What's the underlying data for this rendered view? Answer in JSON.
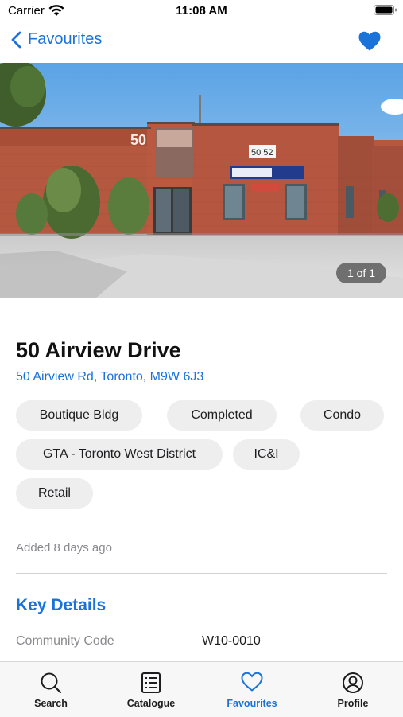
{
  "status_bar": {
    "carrier": "Carrier",
    "time": "11:08 AM",
    "icons": [
      "wifi-icon",
      "battery-icon"
    ]
  },
  "nav": {
    "back_label": "Favourites",
    "favourite_icon": "heart-filled-icon"
  },
  "gallery": {
    "counter": "1 of 1",
    "building_number": "50",
    "unit_sign": "50 52"
  },
  "property": {
    "title": "50 Airview Drive",
    "address": "50 Airview Rd, Toronto, M9W 6J3",
    "tags": [
      "Boutique Bldg",
      "Completed",
      "Condo",
      "GTA - Toronto West District",
      "IC&I",
      "Retail"
    ],
    "added": "Added 8 days ago"
  },
  "key_details": {
    "title": "Key Details",
    "rows": [
      {
        "label": "Community Code",
        "value": "W10-0010"
      }
    ]
  },
  "tab_bar": {
    "tabs": [
      {
        "label": "Search",
        "icon": "search-icon"
      },
      {
        "label": "Catalogue",
        "icon": "list-icon"
      },
      {
        "label": "Favourites",
        "icon": "heart-outline-icon"
      },
      {
        "label": "Profile",
        "icon": "profile-icon"
      }
    ],
    "active": "Favourites"
  },
  "colors": {
    "accent": "#1a73d9",
    "tag_bg": "#eeeeef",
    "muted": "#8a8a8e"
  }
}
